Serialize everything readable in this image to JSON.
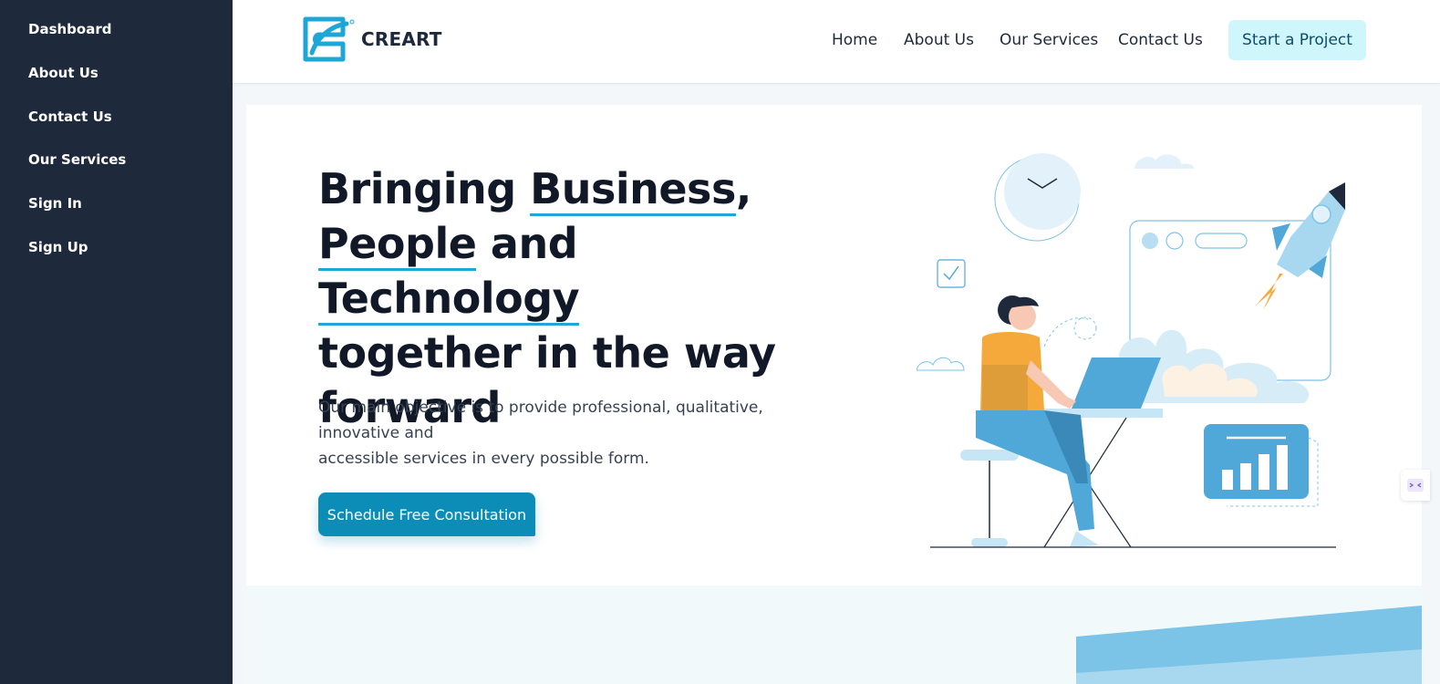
{
  "sidebar": {
    "items": [
      {
        "label": "Dashboard"
      },
      {
        "label": "About Us"
      },
      {
        "label": "Contact Us"
      },
      {
        "label": "Our Services"
      },
      {
        "label": "Sign In"
      },
      {
        "label": "Sign Up"
      }
    ]
  },
  "navbar": {
    "logo_text": "CREART",
    "links": [
      {
        "label": "Home"
      },
      {
        "label": "About Us"
      },
      {
        "label": "Our Services"
      },
      {
        "label": "Contact Us"
      }
    ],
    "cta_label": "Start a Project"
  },
  "hero": {
    "title": {
      "w1": "Bringing ",
      "w2": "Business",
      "w3": ",",
      "w4": "People",
      "w5": " and ",
      "w6": "Technology",
      "w7": "together in the way forward"
    },
    "description_line1": "Our main objective is to provide professional, qualitative, innovative and",
    "description_line2": "accessible services in every possible form.",
    "button_label": "Schedule Free Consultation"
  },
  "colors": {
    "sidebar_bg": "#1e293b",
    "accent": "#0c8db7",
    "cta_bg": "#cff7fb",
    "underline": "#1ea7d6",
    "illustration_blue": "#4fa8d8",
    "illustration_orange": "#f5a93b"
  },
  "icons": {
    "logo": "creart-logo-icon",
    "widget": "translate-widget-icon"
  }
}
